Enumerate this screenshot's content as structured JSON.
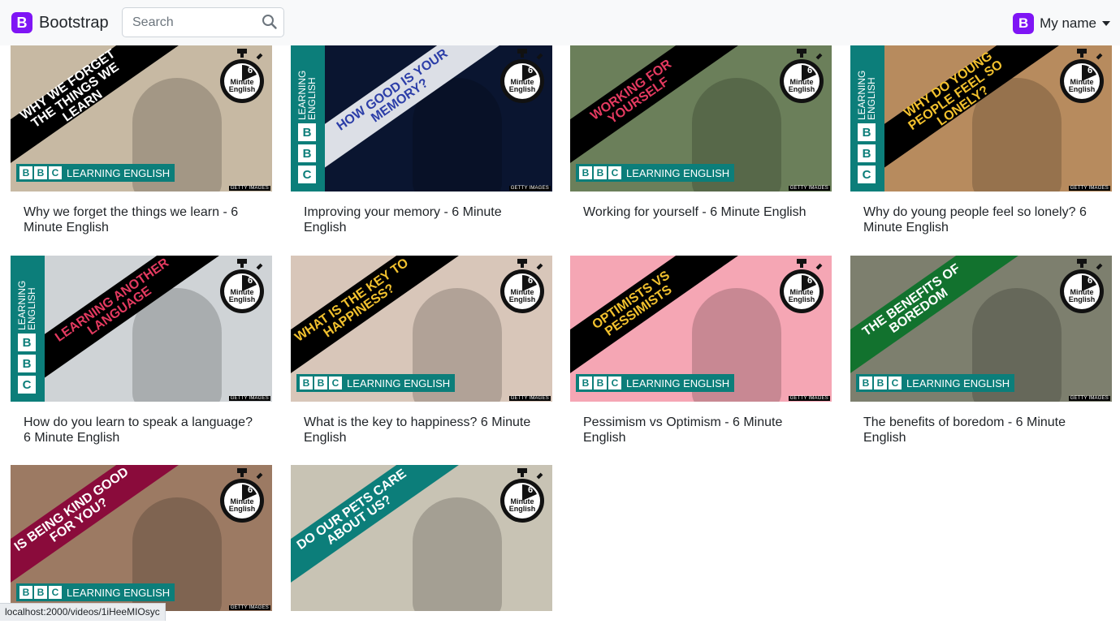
{
  "navbar": {
    "brand_logo": "B",
    "brand": "Bootstrap",
    "search_placeholder": "Search",
    "search_icon": "search-icon",
    "user_logo": "B",
    "user": "My name"
  },
  "videos": [
    {
      "title": "Why we forget the things we learn - 6 Minute English",
      "banner": "WHY WE FORGET THE THINGS WE LEARN",
      "banner_color": "#000000",
      "bg": "#c7b9a3"
    },
    {
      "title": "Improving your memory - 6 Minute English",
      "banner": "HOW GOOD IS YOUR MEMORY?",
      "banner_color": "#dcdfe6",
      "bg": "#0a1530"
    },
    {
      "title": "Working for yourself - 6 Minute English",
      "banner": "WORKING FOR YOURSELF",
      "banner_color": "#000000",
      "bg": "#6b7f5a"
    },
    {
      "title": "Why do young people feel so lonely? 6 Minute English",
      "banner": "WHY DO YOUNG PEOPLE FEEL SO LONELY?",
      "banner_color": "#000000",
      "bg": "#b78b5e"
    },
    {
      "title": "How do you learn to speak a language? 6 Minute English",
      "banner": "LEARNING ANOTHER LANGUAGE",
      "banner_color": "#000000",
      "bg": "#cfd3d6"
    },
    {
      "title": "What is the key to happiness? 6 Minute English",
      "banner": "WHAT IS THE KEY TO HAPPINESS?",
      "banner_color": "#000000",
      "bg": "#d8c6b9"
    },
    {
      "title": "Pessimism vs Optimism - 6 Minute English",
      "banner": "OPTIMISTS VS PESSIMISTS",
      "banner_color": "#000000",
      "bg": "#f5a6b4"
    },
    {
      "title": "The benefits of boredom - 6 Minute English",
      "banner": "THE BENEFITS OF BOREDOM",
      "banner_color": "#12722e",
      "bg": "#7d7f6e"
    },
    {
      "title": "",
      "banner": "IS BEING KIND GOOD FOR YOU?",
      "banner_color": "#8a0b3b",
      "bg": "#9c7a63"
    },
    {
      "title": "",
      "banner": "DO OUR PETS CARE ABOUT US?",
      "banner_color": "#0c7e7a",
      "bg": "#c8c3b4"
    }
  ],
  "bbc": {
    "letters": [
      "B",
      "B",
      "C"
    ],
    "learning_english": "LEARNING ENGLISH",
    "learning": "LEARNING",
    "english": "ENGLISH",
    "getty": "GETTY IMAGES"
  },
  "watch": {
    "six": "6",
    "minute": "Minute",
    "english": "English"
  },
  "status_url": "localhost:2000/videos/1iHeeMIOsyc"
}
